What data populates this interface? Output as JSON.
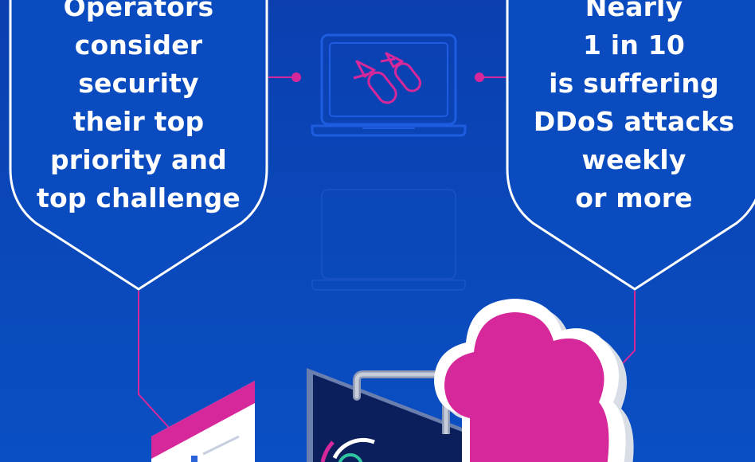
{
  "left_shield": {
    "lines": [
      "Operators",
      "consider",
      "security",
      "their top",
      "priority and",
      "top challenge"
    ]
  },
  "right_shield": {
    "lines": [
      "Nearly",
      "1 in 10",
      "is suffering",
      "DDoS attacks",
      "weekly",
      "or more"
    ]
  },
  "colors": {
    "background": "#0a47b8",
    "shield_fill": "#0a4bbf",
    "shield_border": "#ffffff",
    "accent_magenta": "#d6289a",
    "icon_outline": "#1f5de0",
    "server_dark": "#0a1f5c"
  },
  "icons": [
    "laptop-bombs-icon",
    "laptop-faint-icon",
    "document-icon",
    "server-monitor-icon",
    "cloud-icon"
  ]
}
